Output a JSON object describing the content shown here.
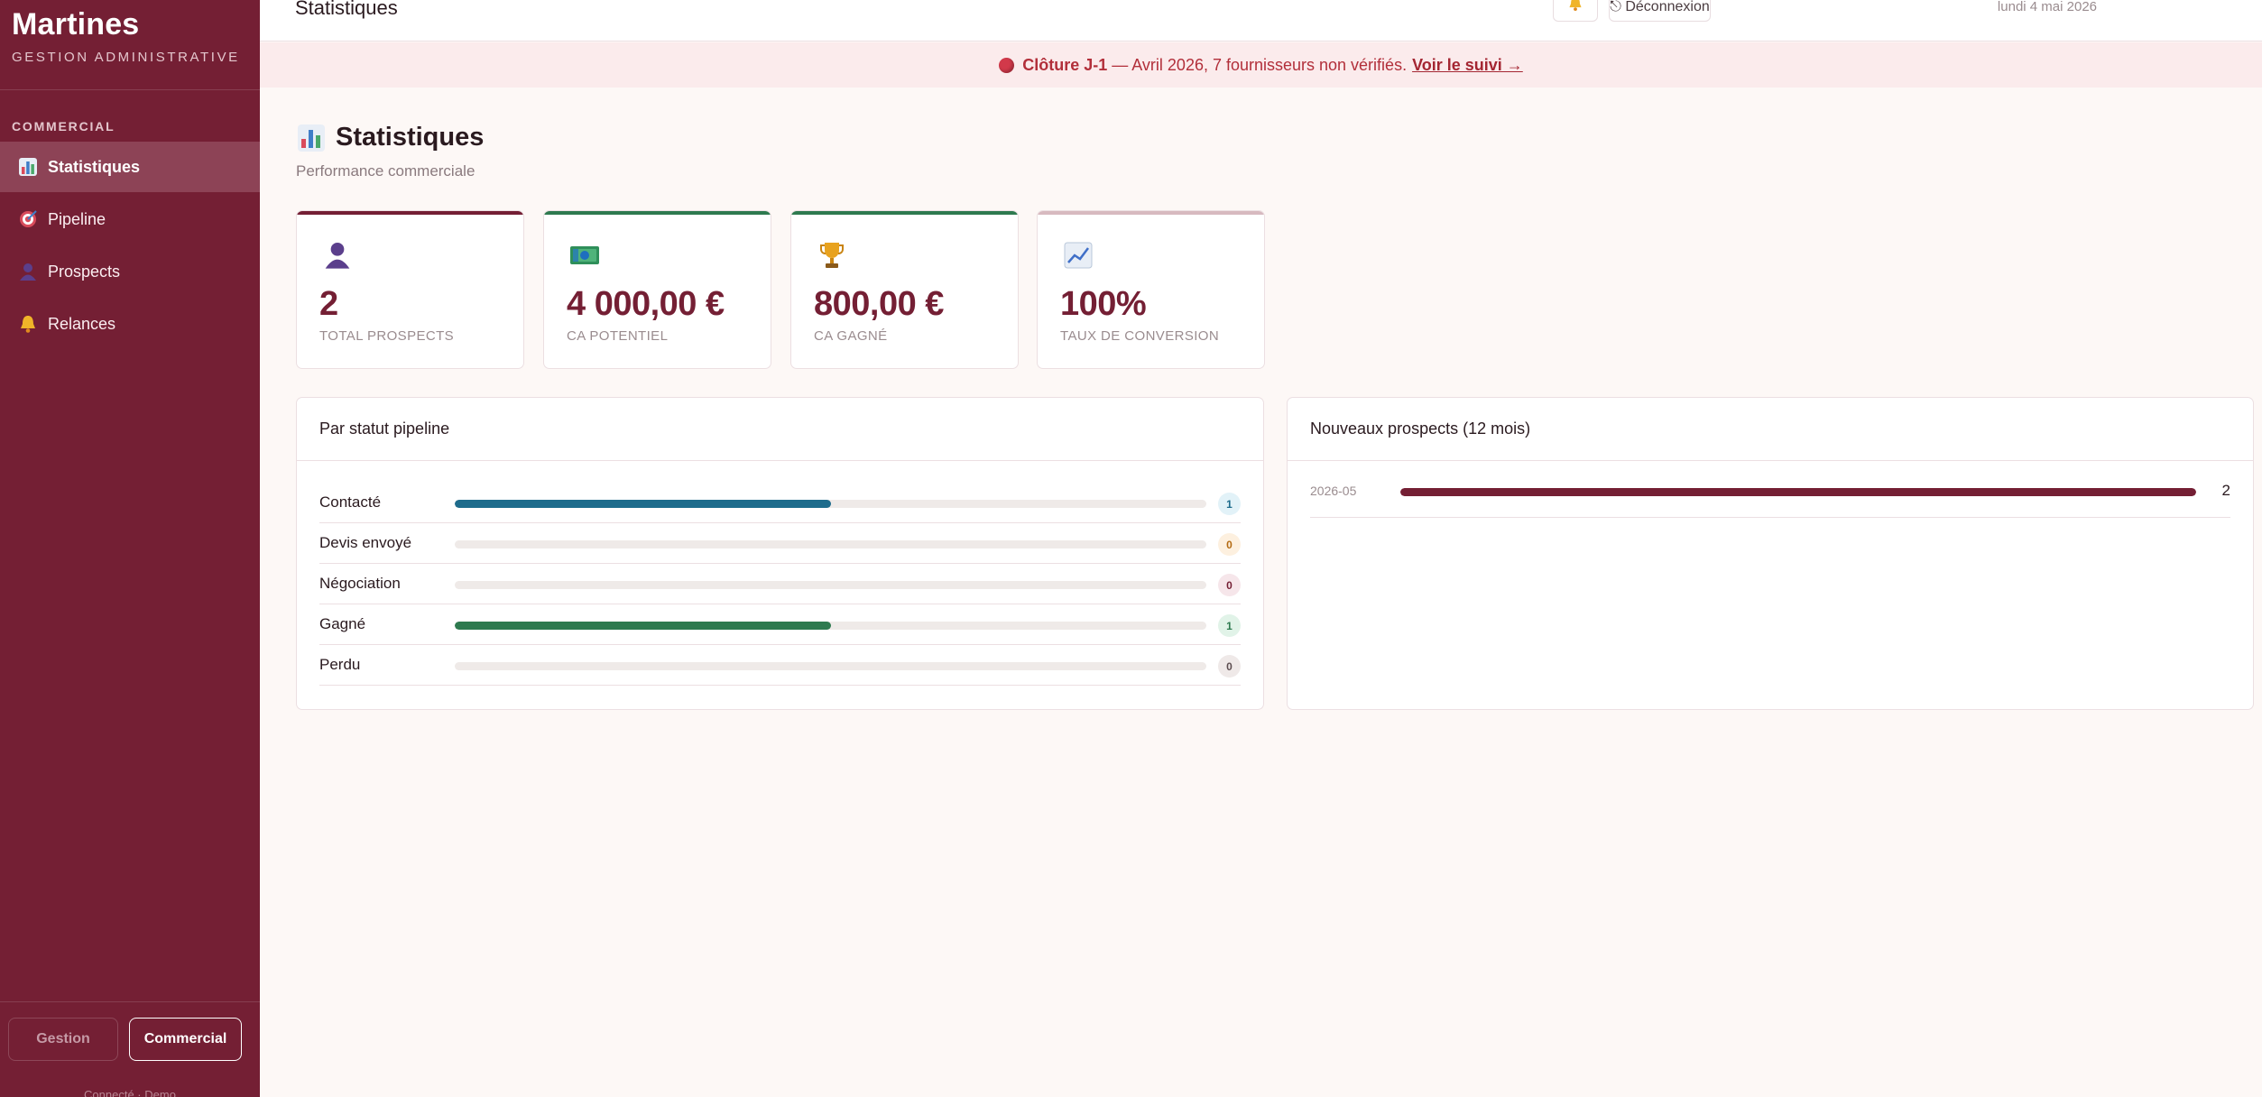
{
  "sidebar": {
    "brand": "Martines",
    "brand_sub": "GESTION ADMINISTRATIVE",
    "section_label": "COMMERCIAL",
    "items": [
      {
        "label": "Statistiques",
        "icon": "bar-chart-icon",
        "active": true
      },
      {
        "label": "Pipeline",
        "icon": "target-icon",
        "active": false
      },
      {
        "label": "Prospects",
        "icon": "person-icon",
        "active": false
      },
      {
        "label": "Relances",
        "icon": "bell-icon",
        "active": false
      }
    ],
    "mode_toggle": {
      "gestion": "Gestion",
      "commercial": "Commercial",
      "selected": "Commercial"
    },
    "footer": "Connecté · Demo"
  },
  "topbar": {
    "title": "Statistiques",
    "date": "lundi 4 mai 2026",
    "logout_label": "⎋ Déconnexion"
  },
  "banner": {
    "prefix": "Clôture J-1",
    "message": " — Avril 2026, 7 fournisseurs non vérifiés.",
    "link": "Voir le suivi →",
    "color": "#b22f3a"
  },
  "page": {
    "title": "Statistiques",
    "subtitle": "Performance commerciale"
  },
  "kpis": [
    {
      "value": "2",
      "label": "TOTAL PROSPECTS",
      "icon": "person-icon",
      "accent": "#741f34"
    },
    {
      "value": "4 000,00 €",
      "label": "CA POTENTIEL",
      "icon": "money-icon",
      "accent": "#2e7a4f"
    },
    {
      "value": "800,00 €",
      "label": "CA GAGNÉ",
      "icon": "trophy-icon",
      "accent": "#2e7a4f"
    },
    {
      "value": "100%",
      "label": "TAUX DE CONVERSION",
      "icon": "trend-chart-icon",
      "accent": "#d7b9bf"
    }
  ],
  "pipeline_panel": {
    "title": "Par statut pipeline",
    "rows": [
      {
        "label": "Contacté",
        "count": "1",
        "fraction": 0.5,
        "color": "#1e6c8c",
        "badge_bg": "#e2f2f8",
        "badge_fg": "#1e6c8c"
      },
      {
        "label": "Devis envoyé",
        "count": "0",
        "fraction": 0,
        "color": "#d8892a",
        "badge_bg": "#fdf0df",
        "badge_fg": "#b36a12"
      },
      {
        "label": "Négociation",
        "count": "0",
        "fraction": 0,
        "color": "#741f34",
        "badge_bg": "#f6e6ea",
        "badge_fg": "#741f34"
      },
      {
        "label": "Gagné",
        "count": "1",
        "fraction": 0.5,
        "color": "#2e7a4f",
        "badge_bg": "#e1f3e8",
        "badge_fg": "#2e7a4f"
      },
      {
        "label": "Perdu",
        "count": "0",
        "fraction": 0,
        "color": "#7a6b6e",
        "badge_bg": "#efe9e8",
        "badge_fg": "#5c4d50"
      }
    ]
  },
  "monthly_panel": {
    "title": "Nouveaux prospects (12 mois)",
    "rows": [
      {
        "label": "2026-05",
        "value": "2",
        "fraction": 1
      }
    ]
  }
}
